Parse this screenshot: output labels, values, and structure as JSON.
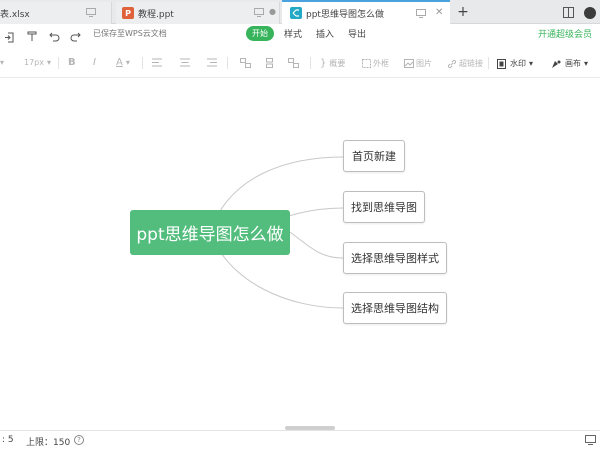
{
  "tabs": [
    {
      "label": "表.xlsx",
      "active": false
    },
    {
      "label": "教程.ppt",
      "active": false,
      "icon_letter": "P",
      "icon_color": "#e0623b"
    },
    {
      "label": "ppt思维导图怎么做",
      "active": true,
      "icon_color": "#23a8c6"
    }
  ],
  "tab_new": "+",
  "menu": {
    "saved_status": "已保存至WPS云文档",
    "items": [
      "开始",
      "样式",
      "插入",
      "导出"
    ],
    "upgrade": "开通超级会员"
  },
  "toolbar": {
    "font_family": "",
    "font_size": "17px",
    "bold": "B",
    "italic": "I",
    "font_color": "A",
    "summary": "概要",
    "frame": "外框",
    "image": "图片",
    "hyperlink": "超链接",
    "watermark": "水印",
    "layout": "画布"
  },
  "mindmap": {
    "root": "ppt思维导图怎么做",
    "children": [
      "首页新建",
      "找到思维导图",
      "选择思维导图样式",
      "选择思维导图结构"
    ]
  },
  "status": {
    "count": ": 5",
    "limit": "上限：150",
    "help": "?"
  },
  "colors": {
    "accent": "#37b45b",
    "root_fill": "#52bd7c",
    "active_tab_border": "#4aa3df"
  }
}
